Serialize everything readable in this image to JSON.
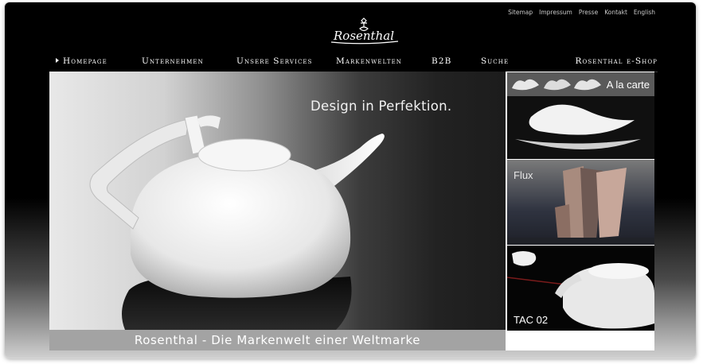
{
  "utility_links": [
    "Sitemap",
    "Impressum",
    "Presse",
    "Kontakt",
    "English"
  ],
  "brand": {
    "logo_text": "Rosenthal"
  },
  "nav": {
    "items": [
      "Homepage",
      "Unternehmen",
      "Unsere Services",
      "Markenwelten",
      "B2B",
      "Suche"
    ],
    "eshop_label": "Rosenthal e-Shop"
  },
  "hero": {
    "title": "Design in Perfektion.",
    "caption": "Rosenthal - Die Markenwelt einer Weltmarke"
  },
  "sidebar": {
    "tiles": [
      {
        "label": "A la carte"
      },
      {
        "label": "Flux"
      },
      {
        "label": "TAC 02"
      }
    ]
  }
}
